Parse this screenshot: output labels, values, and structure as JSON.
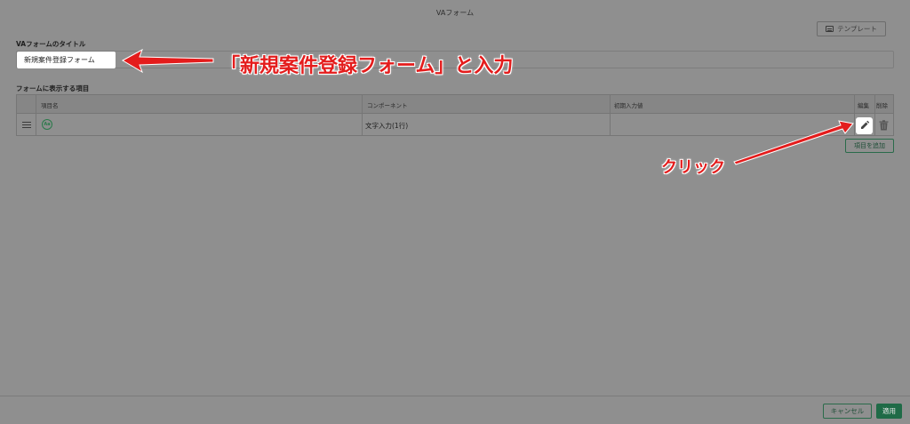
{
  "window": {
    "title": "VAフォーム"
  },
  "toolbar": {
    "template_label": "テンプレート",
    "template_icon": "template-icon"
  },
  "form": {
    "title_section_label": "VAフォームのタイトル",
    "title_value": "新規案件登録フォーム",
    "items_section_label": "フォームに表示する項目"
  },
  "table": {
    "columns": [
      "項目名",
      "コンポーネント",
      "初期入力値",
      "編集",
      "削除"
    ],
    "rows": [
      {
        "name_icon": "text-aa-icon",
        "component": "文字入力(1行)",
        "initial_value": ""
      }
    ]
  },
  "actions": {
    "add_item": "項目を追加",
    "cancel": "キャンセル",
    "apply": "適用"
  },
  "annotations": {
    "input_instruction": "「新規案件登録フォーム」と入力",
    "click_instruction": "クリック",
    "color": "#e41c1c"
  },
  "colors": {
    "accent": "#1f6b47",
    "overlay": "#8f8f8f"
  }
}
